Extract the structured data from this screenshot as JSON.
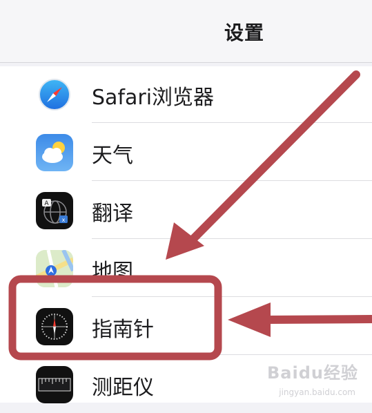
{
  "header": {
    "title": "设置"
  },
  "apps": [
    {
      "label": "Safari浏览器",
      "icon": "safari-icon"
    },
    {
      "label": "天气",
      "icon": "weather-icon"
    },
    {
      "label": "翻译",
      "icon": "translate-icon"
    },
    {
      "label": "地图",
      "icon": "maps-icon"
    },
    {
      "label": "指南针",
      "icon": "compass-icon"
    },
    {
      "label": "测距仪",
      "icon": "measure-icon"
    }
  ],
  "annotation": {
    "color": "#b5484e",
    "highlighted_item": "指南针"
  },
  "watermark": {
    "text": "Baidu经验",
    "subtext": "jingyan.baidu.com"
  }
}
